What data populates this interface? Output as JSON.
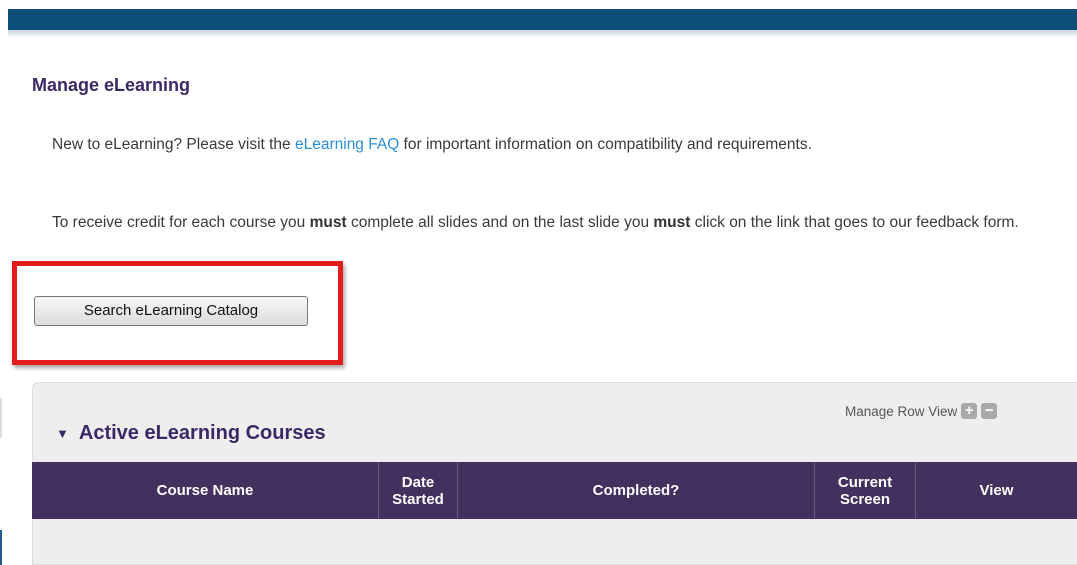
{
  "page": {
    "title": "Manage eLearning",
    "intro_before_link": "New to eLearning? Please visit the ",
    "intro_link": "eLearning FAQ",
    "intro_after_link": " for important information on compatibility and requirements.",
    "credit_part1": "To receive credit for each course you ",
    "credit_must_1": "must",
    "credit_part2": " complete all slides and on the last slide you ",
    "credit_must_2": "must",
    "credit_part3": " click on the link that goes to our feedback form."
  },
  "search_button": {
    "label": "Search eLearning Catalog"
  },
  "panel": {
    "manage_row_view": "Manage Row View",
    "expand_icon": "plus-icon",
    "collapse_icon": "minus-icon",
    "section_title": "Active eLearning Courses",
    "caret_icon": "triangle-down-icon",
    "columns": [
      {
        "line1": "Course Name",
        "line2": ""
      },
      {
        "line1": "Date",
        "line2": "Started"
      },
      {
        "line1": "Completed?",
        "line2": ""
      },
      {
        "line1": "Current",
        "line2": "Screen"
      },
      {
        "line1": "View",
        "line2": ""
      }
    ]
  },
  "colors": {
    "top_bar": "#0b4f79",
    "title": "#3b2865",
    "link": "#2a8fd6",
    "table_header": "#44305f",
    "highlight": "#e21b1b"
  }
}
